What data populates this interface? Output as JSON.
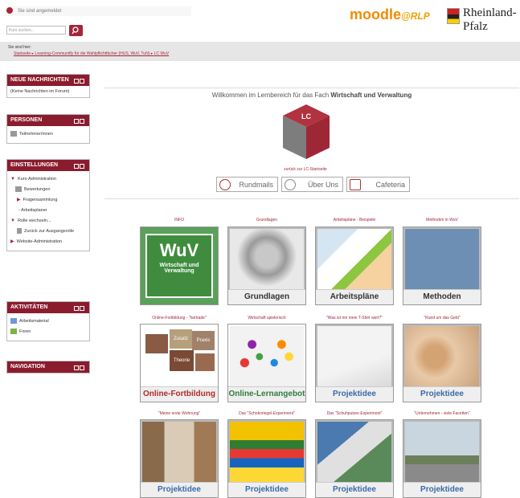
{
  "header": {
    "login_status": "Sie sind angemeldet",
    "search_placeholder": "Kurs suchen...",
    "logo_moodle": "moodle",
    "logo_rlp": "@RLP",
    "state_name": "Rheinland-Pfalz"
  },
  "breadcrumb": {
    "label": "Sie sind hier:",
    "items": [
      "Startseite",
      "Learning-Communitfy für die Wahlpflichtfächer (HUS, WuV, TuN)",
      "LC WuV"
    ]
  },
  "blocks": {
    "news": {
      "title": "NEUE NACHRICHTEN",
      "text": "(Keine Nachrichten im Forum)"
    },
    "persons": {
      "title": "PERSONEN",
      "item": "Teilnehmer/innen"
    },
    "settings": {
      "title": "EINSTELLUNGEN",
      "items": [
        "Kurs-Administration",
        "Bewertungen",
        "Fragensammlung",
        "Arbeitsplaner",
        "Rolle wechseln...",
        "Zurück zur Ausgangsrolle",
        "Website-Administration"
      ]
    },
    "activities": {
      "title": "AKTIVITÄTEN",
      "items": [
        "Arbeitsmaterial",
        "Foren"
      ]
    },
    "navigation": {
      "title": "NAVIGATION"
    }
  },
  "main": {
    "welcome_prefix": "Willkommen im Lernbereich für das Fach",
    "welcome_subject": "Wirtschaft und Verwaltung",
    "cube_label": "LC",
    "back_link": "zurück zur LC-Startseite",
    "nav_buttons": [
      "Rundmails",
      "Über Uns",
      "Cafeteria"
    ]
  },
  "tiles": [
    {
      "caption": "INFO",
      "label": "WuV",
      "sub": "Wirtschaft und Verwaltung"
    },
    {
      "caption": "Grundlagen",
      "label": "Grundlagen"
    },
    {
      "caption": "Arbeitspläne - Beispiele",
      "label": "Arbeitspläne"
    },
    {
      "caption": "Methoden in WuV",
      "label": "Methoden"
    },
    {
      "caption": "Online-Fortbildung - \"fairtrade\"",
      "label": "Online-Fortbildung",
      "puzzle": [
        "Zusatz",
        "Praxis",
        "Theorie"
      ]
    },
    {
      "caption": "Wirtschaft spielerisch",
      "label": "Online-Lernangebot"
    },
    {
      "caption": "\"Was ist mir mein T-Shirt wert?\"",
      "label": "Projektidee"
    },
    {
      "caption": "\"Rund um das Geld\"",
      "label": "Projektidee"
    },
    {
      "caption": "\"Meine erste Wohnung\"",
      "label": "Projektidee"
    },
    {
      "caption": "Das \"Schokoriegel-Experiment\"",
      "label": "Projektidee"
    },
    {
      "caption": "Das \"Schuhputzer-Experiment\"",
      "label": "Projektidee"
    },
    {
      "caption": "\"Unternehmen - viele Facetten\"",
      "label": "Projektidee"
    }
  ],
  "colors": {
    "accent": "#8b1c2e",
    "link": "#a3263a",
    "projekt_label": "#3a6aa8",
    "green_label": "#2e7d3e",
    "red_label": "#b02a2a"
  }
}
